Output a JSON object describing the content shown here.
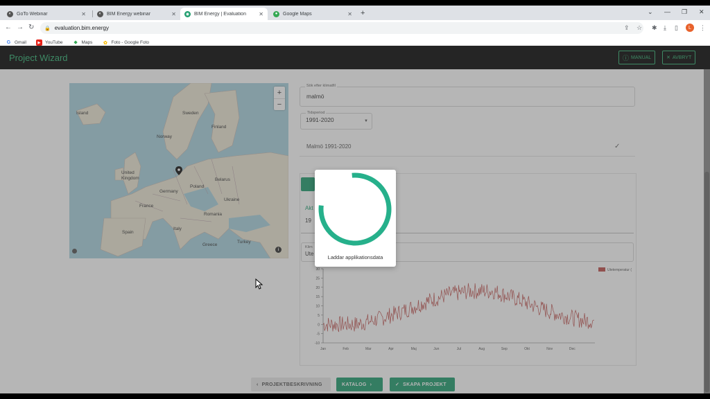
{
  "browser": {
    "tabs": [
      {
        "label": "GoTo Webinar",
        "active": false
      },
      {
        "label": "BIM Energy webinar",
        "active": false
      },
      {
        "label": "BIM Energy | Evaluation",
        "active": true
      },
      {
        "label": "Google Maps",
        "active": false
      }
    ],
    "url": "evaluation.bim.energy",
    "profile_initial": "L",
    "bookmarks": [
      {
        "label": "Gmail",
        "icon": "google-icon"
      },
      {
        "label": "YouTube",
        "icon": "youtube-icon"
      },
      {
        "label": "Maps",
        "icon": "maps-icon"
      },
      {
        "label": "Foto - Google Foto",
        "icon": "photos-icon"
      }
    ]
  },
  "app": {
    "title": "Project Wizard",
    "manual_label": "MANUAL",
    "cancel_label": "AVBRYT",
    "accent_color": "#1f9d6e"
  },
  "map": {
    "labels": [
      {
        "text": "Island"
      },
      {
        "text": "Sweden"
      },
      {
        "text": "Finland"
      },
      {
        "text": "Norway"
      },
      {
        "text": "United Kingdom"
      },
      {
        "text": "Belarus"
      },
      {
        "text": "Poland"
      },
      {
        "text": "Germany"
      },
      {
        "text": "Ukraine"
      },
      {
        "text": "France"
      },
      {
        "text": "Romania"
      },
      {
        "text": "Spain"
      },
      {
        "text": "Italy"
      },
      {
        "text": "Turkey"
      },
      {
        "text": "Greece"
      }
    ]
  },
  "form": {
    "search_label": "Sök efter klimatfil",
    "search_value": "malmö",
    "period_label": "Tidsperiod",
    "period_value": "1991-2020",
    "result_text": "Malmö 1991-2020",
    "active_label": "Akt",
    "active_value": "19",
    "third_label": "Klim",
    "third_value": "Ute"
  },
  "chart_data": {
    "type": "line",
    "series": [
      {
        "name": "Utetemperatur (",
        "color": "#c0504d"
      }
    ],
    "x_ticks": [
      "Jan",
      "Feb",
      "Mar",
      "Apr",
      "Maj",
      "Jun",
      "Jul",
      "Aug",
      "Sep",
      "Okt",
      "Nov",
      "Dec"
    ],
    "y_ticks": [
      -10,
      -5,
      0,
      5,
      10,
      15,
      20,
      25,
      30
    ],
    "ylim": [
      -10,
      30
    ],
    "monthly_mean": [
      0,
      0,
      3,
      7,
      12,
      16,
      18,
      18,
      14,
      9,
      5,
      2
    ]
  },
  "bottom": {
    "back_label": "PROJEKTBESKRIVNING",
    "catalog_label": "KATALOG",
    "create_label": "SKAPA PROJEKT"
  },
  "loading": {
    "text": "Laddar applikationsdata",
    "progress": 0.78
  }
}
